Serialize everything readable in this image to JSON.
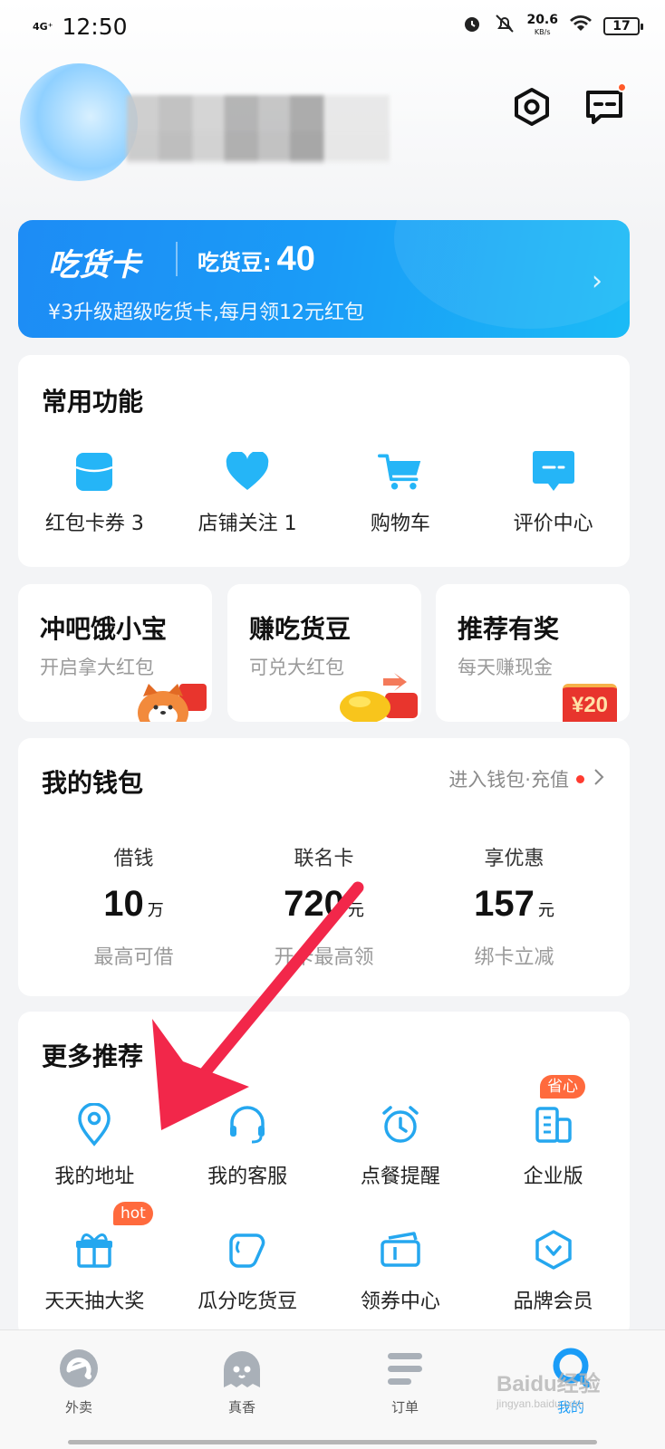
{
  "status_bar": {
    "network": "4G⁺",
    "time": "12:50",
    "speed": "20.6",
    "speed_unit": "KB/s",
    "battery": "17"
  },
  "header": {
    "settings_icon": "settings-hexagon-icon",
    "message_icon": "message-icon"
  },
  "food_card": {
    "title": "吃货卡",
    "beans_label": "吃货豆:",
    "beans_value": "40",
    "subtitle": "¥3升级超级吃货卡,每月领12元红包",
    "arrow": "›"
  },
  "common_functions": {
    "title": "常用功能",
    "items": [
      {
        "label": "红包卡券 3",
        "icon": "coupon-icon"
      },
      {
        "label": "店铺关注 1",
        "icon": "heart-icon"
      },
      {
        "label": "购物车",
        "icon": "cart-icon"
      },
      {
        "label": "评价中心",
        "icon": "review-icon"
      }
    ]
  },
  "promos": [
    {
      "title": "冲吧饿小宝",
      "subtitle": "开启拿大红包"
    },
    {
      "title": "赚吃货豆",
      "subtitle": "可兑大红包"
    },
    {
      "title": "推荐有奖",
      "subtitle": "每天赚现金",
      "badge": "¥20"
    }
  ],
  "wallet": {
    "title": "我的钱包",
    "enter_label": "进入钱包·充值",
    "columns": [
      {
        "header": "借钱",
        "value": "10",
        "unit": "万",
        "desc": "最高可借"
      },
      {
        "header": "联名卡",
        "value": "720",
        "unit": "元",
        "desc": "开卡最高领"
      },
      {
        "header": "享优惠",
        "value": "157",
        "unit": "元",
        "desc": "绑卡立减"
      }
    ]
  },
  "more": {
    "title": "更多推荐",
    "items": [
      {
        "label": "我的地址",
        "icon": "location-pin-icon"
      },
      {
        "label": "我的客服",
        "icon": "headset-icon"
      },
      {
        "label": "点餐提醒",
        "icon": "alarm-clock-icon"
      },
      {
        "label": "企业版",
        "icon": "building-icon",
        "tag": "省心"
      },
      {
        "label": "天天抽大奖",
        "icon": "gift-icon",
        "tag": "hot"
      },
      {
        "label": "瓜分吃货豆",
        "icon": "bean-icon"
      },
      {
        "label": "领券中心",
        "icon": "ticket-icon"
      },
      {
        "label": "品牌会员",
        "icon": "brand-badge-icon"
      }
    ]
  },
  "bottom_nav": [
    {
      "label": "外卖",
      "icon": "takeout-e-icon"
    },
    {
      "label": "真香",
      "icon": "ghost-icon"
    },
    {
      "label": "订单",
      "icon": "order-list-icon"
    },
    {
      "label": "我的",
      "icon": "profile-icon",
      "active": true
    }
  ],
  "watermark": {
    "text": "Baidu经验",
    "sub": "jingyan.baidu.com"
  },
  "colors": {
    "accent": "#1a9cf7",
    "tag": "#ff6a3d",
    "arrow": "#f2274a"
  }
}
